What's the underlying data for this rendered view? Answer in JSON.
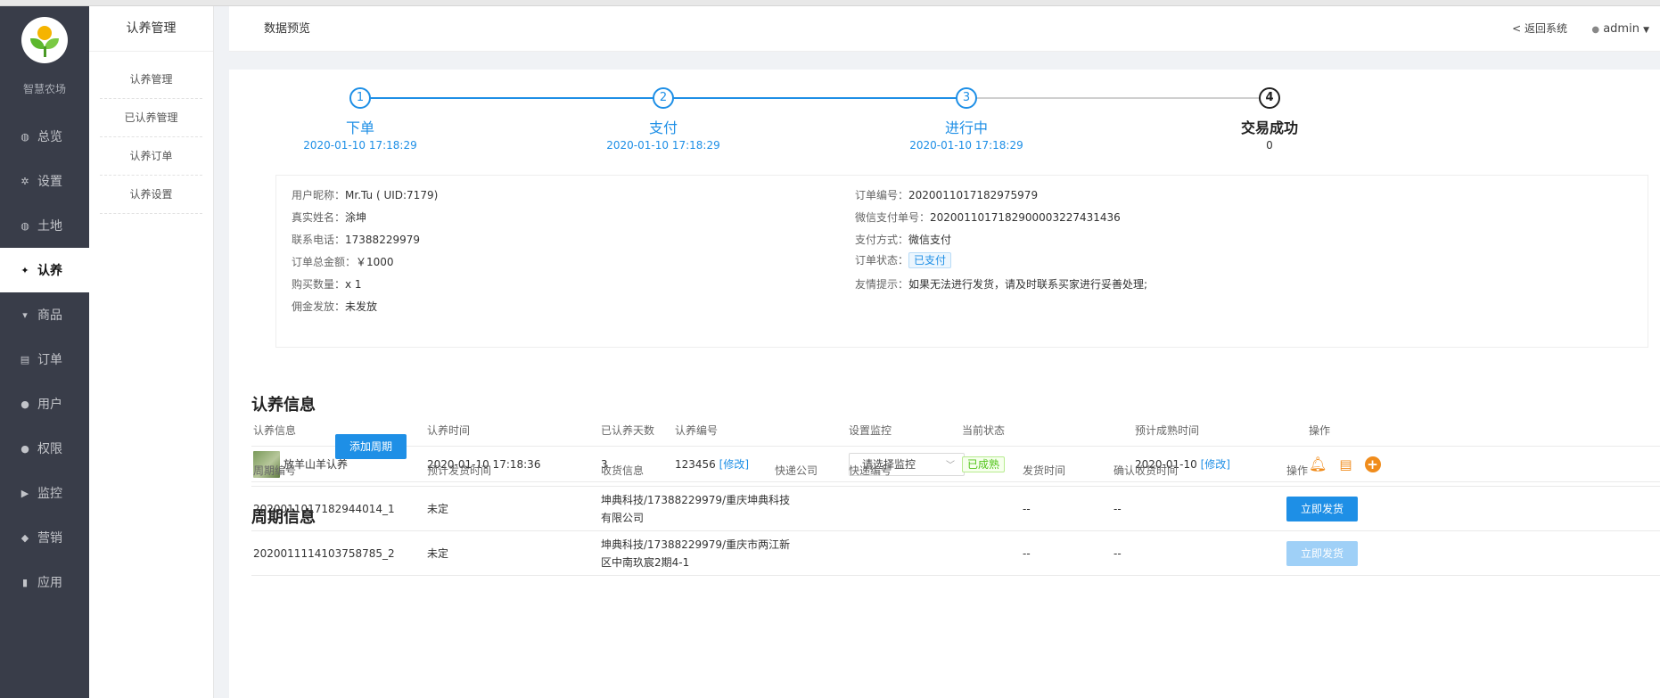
{
  "sidebar": {
    "brand": "智慧农场",
    "items": [
      {
        "label": "总览",
        "icon": "globe-icon"
      },
      {
        "label": "设置",
        "icon": "gear-icon"
      },
      {
        "label": "土地",
        "icon": "globe-icon"
      },
      {
        "label": "认养",
        "icon": "twitter-icon"
      },
      {
        "label": "商品",
        "icon": "cart-icon"
      },
      {
        "label": "订单",
        "icon": "list-icon"
      },
      {
        "label": "用户",
        "icon": "user-icon"
      },
      {
        "label": "权限",
        "icon": "user-icon"
      },
      {
        "label": "监控",
        "icon": "play-icon"
      },
      {
        "label": "营销",
        "icon": "tags-icon"
      },
      {
        "label": "应用",
        "icon": "book-icon"
      }
    ],
    "active": "认养"
  },
  "subnav": {
    "title": "认养管理",
    "items": [
      "认养管理",
      "已认养管理",
      "认养订单",
      "认养设置"
    ]
  },
  "header": {
    "title": "数据预览",
    "back": "< 返回系统",
    "user": "admin"
  },
  "steps": [
    {
      "num": "1",
      "label": "下单",
      "time": "2020-01-10 17:18:29"
    },
    {
      "num": "2",
      "label": "支付",
      "time": "2020-01-10 17:18:29"
    },
    {
      "num": "3",
      "label": "进行中",
      "time": "2020-01-10 17:18:29"
    },
    {
      "num": "4",
      "label": "交易成功",
      "time": "0"
    }
  ],
  "order_info": {
    "left": [
      {
        "label": "用户昵称：",
        "value": "Mr.Tu ( UID:7179)"
      },
      {
        "label": "真实姓名：",
        "value": "涂坤"
      },
      {
        "label": "联系电话：",
        "value": "17388229979"
      },
      {
        "label": "订单总金额：",
        "value": "￥1000"
      },
      {
        "label": "购买数量：",
        "value": "x 1"
      },
      {
        "label": "佣金发放：",
        "value": "未发放"
      }
    ],
    "right": {
      "order_no_label": "订单编号：",
      "order_no": "2020011017182975979",
      "wx_no_label": "微信支付单号：",
      "wx_no": "2020011017182900003227431436",
      "pay_method_label": "支付方式：",
      "pay_method": "微信支付",
      "status_label": "订单状态：",
      "status": "已支付",
      "tip_label": "友情提示：",
      "tip": "如果无法进行发货，请及时联系买家进行妥善处理;"
    }
  },
  "adopt": {
    "title": "认养信息",
    "headers": [
      "认养信息",
      "认养时间",
      "已认养天数",
      "认养编号",
      "设置监控",
      "当前状态",
      "预计成熟时间",
      "操作"
    ],
    "row": {
      "name": "放羊山羊认养",
      "time": "2020-01-10 17:18:36",
      "days": "3",
      "code": "123456",
      "edit": "[修改]",
      "monitor_placeholder": "请选择监控",
      "status": "已成熟",
      "mature": "2020-01-10",
      "mature_edit": "[修改]"
    }
  },
  "cycle": {
    "title": "周期信息",
    "add_button": "添加周期",
    "headers": [
      "周期编号",
      "预计发货时间",
      "收货信息",
      "快递公司",
      "快递编号",
      "发货时间",
      "确认收货时间",
      "操作"
    ],
    "rows": [
      {
        "code": "2020011017182944014_1",
        "eta": "未定",
        "addr1": "坤典科技/17388229979/重庆坤典科技",
        "addr2": "有限公司",
        "courier": "",
        "tracking": "",
        "ship_time": "--",
        "confirm_time": "--",
        "action": "立即发货"
      },
      {
        "code": "2020011114103758785_2",
        "eta": "未定",
        "addr1": "坤典科技/17388229979/重庆市两江新",
        "addr2": "区中南玖宸2期4-1",
        "courier": "",
        "tracking": "",
        "ship_time": "--",
        "confirm_time": "--",
        "action": "立即发货"
      }
    ]
  },
  "colors": {
    "accent": "#1e8fe6",
    "sidebar_bg": "#393d49",
    "success": "#52c41a",
    "warning": "#f08c1c"
  }
}
